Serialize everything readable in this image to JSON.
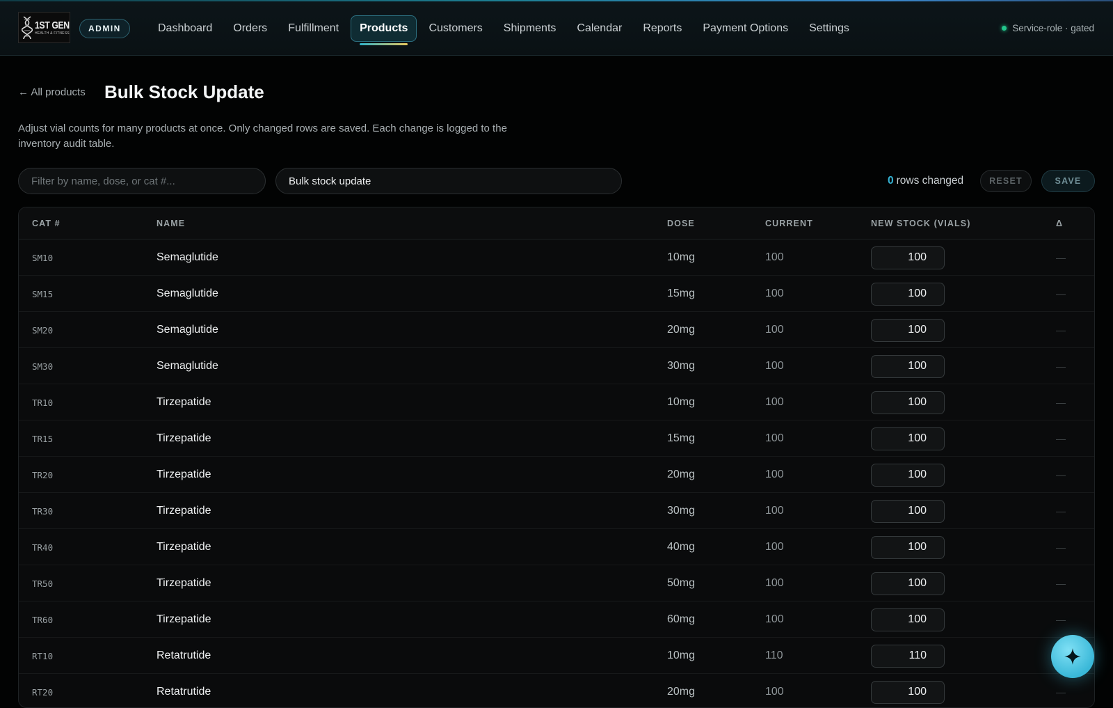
{
  "brand": {
    "logo_main": "1ST GEN",
    "logo_sub": "HEALTH & FITNESS",
    "badge": "ADMIN"
  },
  "nav": {
    "items": [
      {
        "label": "Dashboard",
        "active": false
      },
      {
        "label": "Orders",
        "active": false
      },
      {
        "label": "Fulfillment",
        "active": false
      },
      {
        "label": "Products",
        "active": true
      },
      {
        "label": "Customers",
        "active": false
      },
      {
        "label": "Shipments",
        "active": false
      },
      {
        "label": "Calendar",
        "active": false
      },
      {
        "label": "Reports",
        "active": false
      },
      {
        "label": "Payment Options",
        "active": false
      },
      {
        "label": "Settings",
        "active": false
      }
    ]
  },
  "status": {
    "text": "Service-role · gated",
    "color": "#22c58b"
  },
  "page": {
    "back_label": "← All products",
    "title": "Bulk Stock Update",
    "description": "Adjust vial counts for many products at once. Only changed rows are saved. Each change is logged to the inventory audit table."
  },
  "toolbar": {
    "filter_placeholder": "Filter by name, dose, or cat #...",
    "filter_value": "",
    "mode_select": "Bulk stock update",
    "rows_changed_count": "0",
    "rows_changed_label": "rows changed",
    "reset_label": "RESET",
    "save_label": "SAVE"
  },
  "table": {
    "headers": {
      "cat": "CAT #",
      "name": "NAME",
      "dose": "DOSE",
      "current": "CURRENT",
      "new_stock": "NEW STOCK (VIALS)",
      "delta": "Δ"
    },
    "rows": [
      {
        "cat": "SM10",
        "name": "Semaglutide",
        "dose": "10mg",
        "current": "100",
        "new_stock": "100",
        "delta": "—"
      },
      {
        "cat": "SM15",
        "name": "Semaglutide",
        "dose": "15mg",
        "current": "100",
        "new_stock": "100",
        "delta": "—"
      },
      {
        "cat": "SM20",
        "name": "Semaglutide",
        "dose": "20mg",
        "current": "100",
        "new_stock": "100",
        "delta": "—"
      },
      {
        "cat": "SM30",
        "name": "Semaglutide",
        "dose": "30mg",
        "current": "100",
        "new_stock": "100",
        "delta": "—"
      },
      {
        "cat": "TR10",
        "name": "Tirzepatide",
        "dose": "10mg",
        "current": "100",
        "new_stock": "100",
        "delta": "—"
      },
      {
        "cat": "TR15",
        "name": "Tirzepatide",
        "dose": "15mg",
        "current": "100",
        "new_stock": "100",
        "delta": "—"
      },
      {
        "cat": "TR20",
        "name": "Tirzepatide",
        "dose": "20mg",
        "current": "100",
        "new_stock": "100",
        "delta": "—"
      },
      {
        "cat": "TR30",
        "name": "Tirzepatide",
        "dose": "30mg",
        "current": "100",
        "new_stock": "100",
        "delta": "—"
      },
      {
        "cat": "TR40",
        "name": "Tirzepatide",
        "dose": "40mg",
        "current": "100",
        "new_stock": "100",
        "delta": "—"
      },
      {
        "cat": "TR50",
        "name": "Tirzepatide",
        "dose": "50mg",
        "current": "100",
        "new_stock": "100",
        "delta": "—"
      },
      {
        "cat": "TR60",
        "name": "Tirzepatide",
        "dose": "60mg",
        "current": "100",
        "new_stock": "100",
        "delta": "—"
      },
      {
        "cat": "RT10",
        "name": "Retatrutide",
        "dose": "10mg",
        "current": "110",
        "new_stock": "110",
        "delta": "—"
      },
      {
        "cat": "RT20",
        "name": "Retatrutide",
        "dose": "20mg",
        "current": "100",
        "new_stock": "100",
        "delta": "—"
      }
    ]
  },
  "fab": {
    "icon": "sparkle-icon"
  },
  "colors": {
    "accent": "#35b5d6",
    "background": "#020303"
  }
}
